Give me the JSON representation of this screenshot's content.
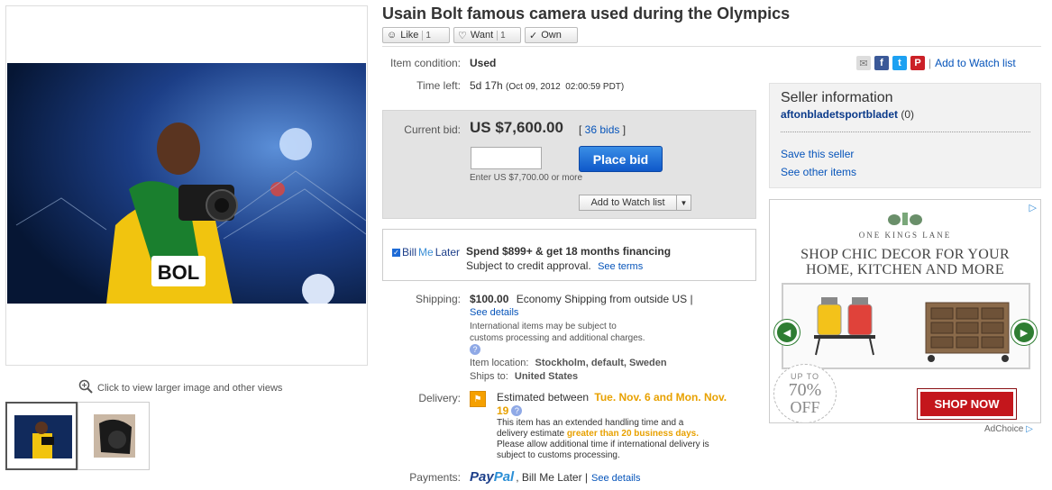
{
  "listing": {
    "title": "Usain Bolt famous camera used during the Olympics"
  },
  "social": {
    "like_label": "Like",
    "like_count": "1",
    "want_label": "Want",
    "want_count": "1",
    "own_label": "Own"
  },
  "details": {
    "condition_label": "Item condition:",
    "condition_value": "Used",
    "time_left_label": "Time left:",
    "time_left_value": "5d 17h",
    "time_left_date": "(Oct 09, 2012  02:00:59 PDT)"
  },
  "share": {
    "add_to_watch_list": "Add to Watch list"
  },
  "bid": {
    "current_bid_label": "Current bid:",
    "current_bid_value": "US $7,600.00",
    "bids_count": "36 bids",
    "bid_input_value": "",
    "place_bid_label": "Place bid",
    "enter_hint": "Enter US $7,700.00 or more",
    "watch_button_label": "Add to Watch list"
  },
  "billmelater": {
    "logo_bill": "Bill",
    "logo_me": "Me",
    "logo_later": "Later",
    "headline": "Spend $899+ & get 18 months financing",
    "subtext": "Subject to credit approval.",
    "see_terms": "See terms"
  },
  "shipping": {
    "label": "Shipping:",
    "price": "$100.00",
    "method": "Economy Shipping from outside US |",
    "see_details": "See details",
    "intl_note_1": "International items may be subject to",
    "intl_note_2": "customs processing and additional charges.",
    "item_location_label": "Item location:",
    "item_location_value": "Stockholm, default, Sweden",
    "ships_to_label": "Ships to:",
    "ships_to_value": "United States"
  },
  "delivery": {
    "label": "Delivery:",
    "estimated_prefix": "Estimated between",
    "estimated_dates_1": "Tue. Nov. 6 and Mon. Nov.",
    "estimated_dates_2": "19",
    "note_1": "This item has an extended handling time and a",
    "note_2_prefix": "delivery estimate",
    "note_2_highlight": "greater than 20 business days.",
    "note_3": "Please allow additional time if international delivery is",
    "note_4": "subject to customs processing."
  },
  "payments": {
    "label": "Payments:",
    "paypal_pay": "Pay",
    "paypal_pal": "Pal",
    "bill_me_later": ", Bill Me Later |",
    "see_details": "See details"
  },
  "seller": {
    "heading": "Seller information",
    "name": "aftonbladetsportbladet",
    "feedback": "(0)",
    "save_seller": "Save this seller",
    "see_other_items": "See other items"
  },
  "images": {
    "zoom_hint": "Click to view larger image and other views",
    "bib_text": "BOL"
  },
  "ad": {
    "brand": "ONE KINGS LANE",
    "headline_1": "SHOP CHIC DECOR FOR YOUR",
    "headline_2": "HOME, KITCHEN AND MORE",
    "badge_up_to": "UP TO",
    "badge_percent": "70%",
    "badge_off": "OFF",
    "cta": "SHOP NOW",
    "adchoice": "AdChoice"
  },
  "colors": {
    "link": "#0654ba",
    "orange": "#e8a100",
    "place_bid": "#1d6ad6",
    "ad_green": "#2e7d32",
    "ad_red": "#c4161c"
  }
}
